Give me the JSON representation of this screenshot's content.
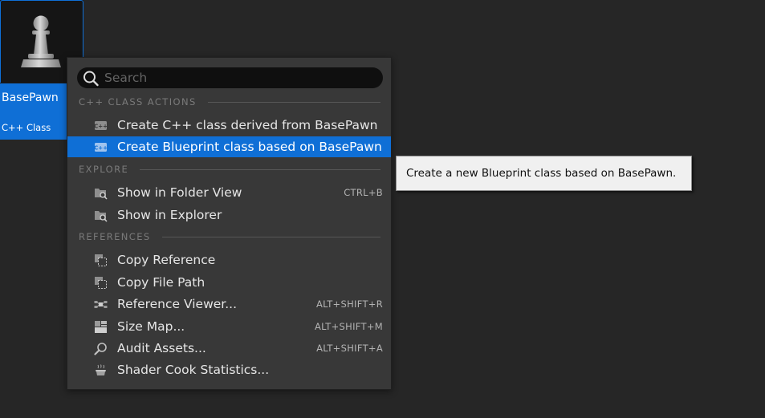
{
  "asset": {
    "name": "BasePawn",
    "type": "C++ Class",
    "icon": "pawn-icon"
  },
  "menu": {
    "search": {
      "placeholder": "Search",
      "value": ""
    },
    "sections": {
      "cpp_class_actions": "C++ CLASS ACTIONS",
      "explore": "EXPLORE",
      "references": "REFERENCES"
    },
    "items": {
      "create_cpp": {
        "label": "Create C++ class derived from BasePawn",
        "icon": "cpp-class-icon"
      },
      "create_blueprint": {
        "label": "Create Blueprint class based on BasePawn",
        "icon": "cpp-class-icon"
      },
      "show_folder_view": {
        "label": "Show in Folder View",
        "shortcut": "CTRL+B",
        "icon": "folder-search-icon"
      },
      "show_explorer": {
        "label": "Show in Explorer",
        "icon": "folder-search-icon"
      },
      "copy_reference": {
        "label": "Copy Reference",
        "icon": "copy-icon"
      },
      "copy_file_path": {
        "label": "Copy File Path",
        "icon": "copy-icon"
      },
      "reference_viewer": {
        "label": "Reference Viewer...",
        "shortcut": "ALT+SHIFT+R",
        "icon": "reference-graph-icon"
      },
      "size_map": {
        "label": "Size Map...",
        "shortcut": "ALT+SHIFT+M",
        "icon": "size-map-icon"
      },
      "audit_assets": {
        "label": "Audit Assets...",
        "shortcut": "ALT+SHIFT+A",
        "icon": "audit-magnifier-icon"
      },
      "shader_cook_stats": {
        "label": "Shader Cook Statistics...",
        "icon": "cooking-pot-icon"
      }
    }
  },
  "tooltip": {
    "text": "Create a new Blueprint class based on BasePawn."
  },
  "colors": {
    "accent": "#0f6fd6",
    "background": "#262626",
    "menu_background": "#383838",
    "tooltip_background": "#f0f0f0"
  }
}
